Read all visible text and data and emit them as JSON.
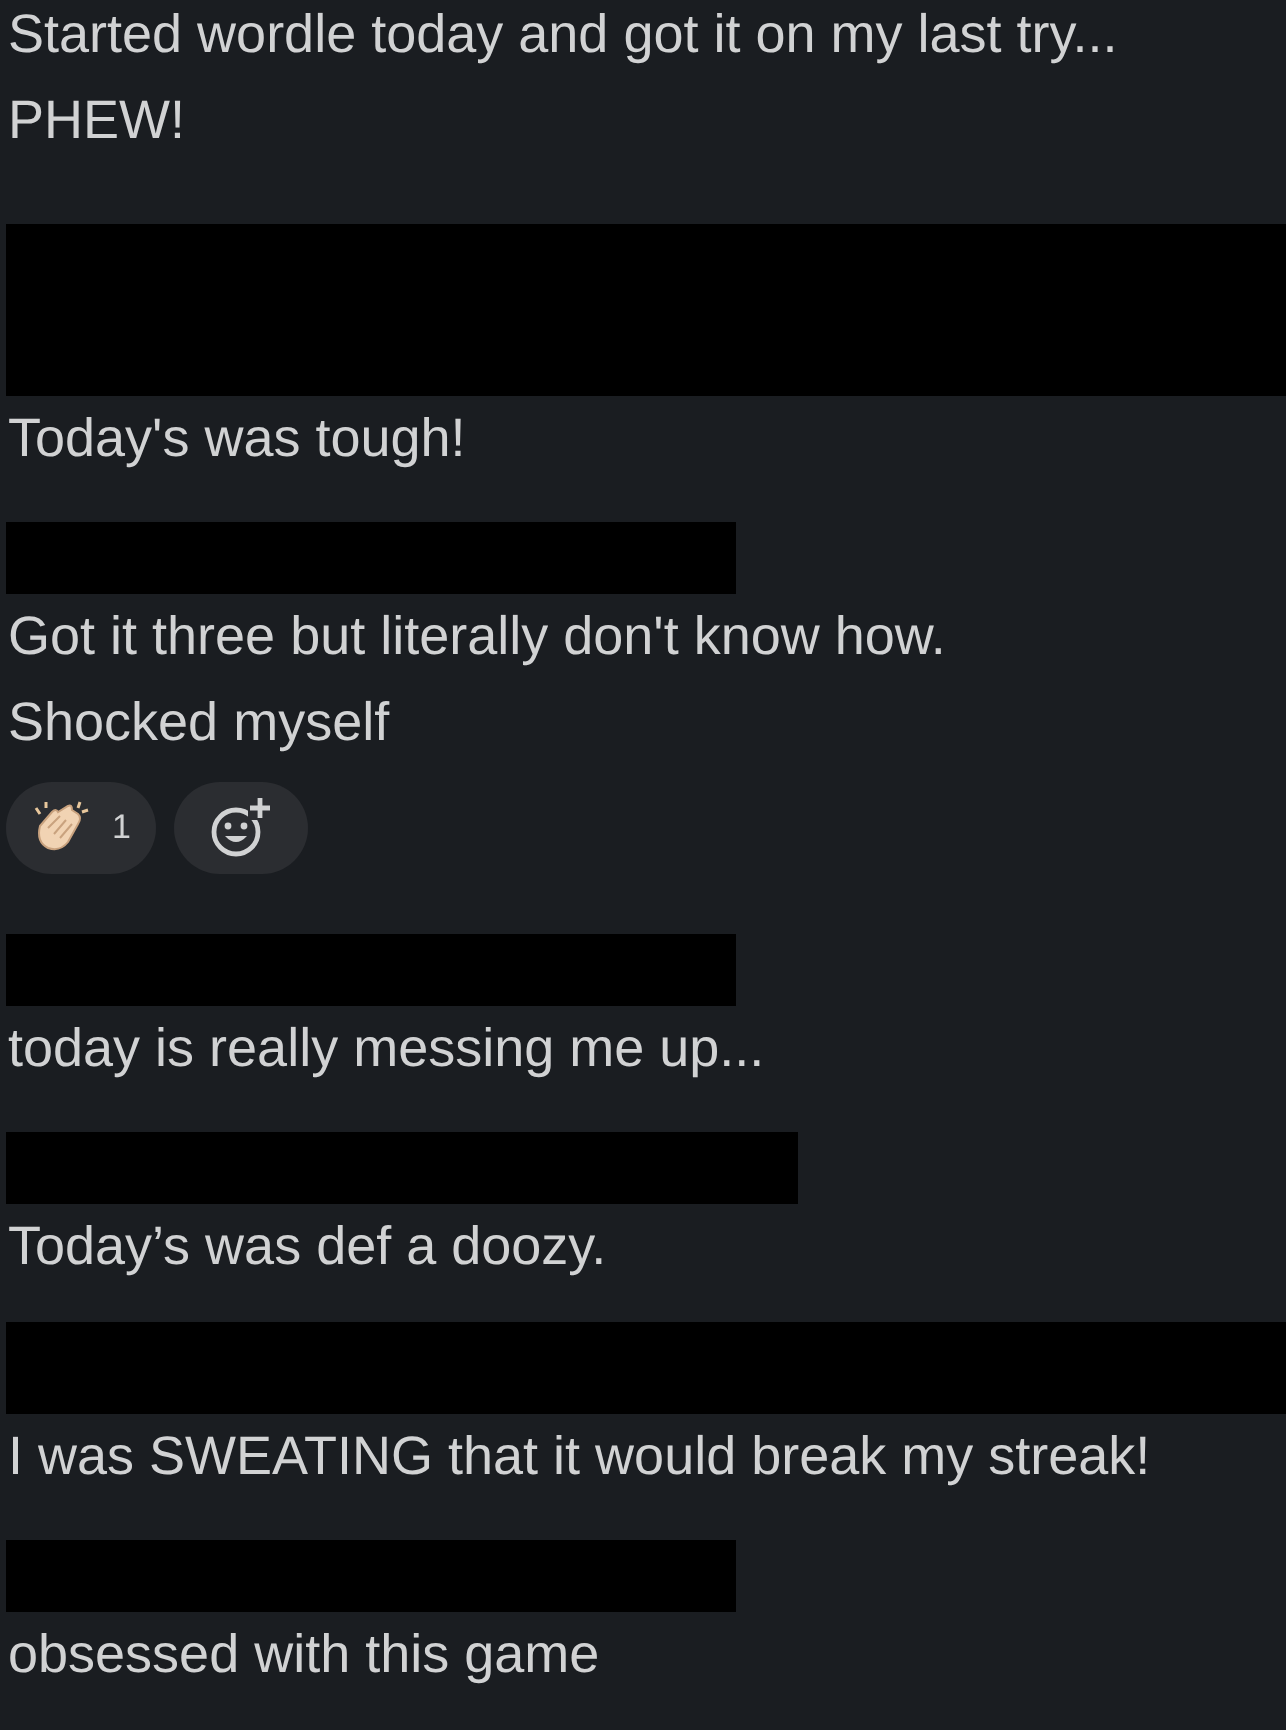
{
  "blocks": [
    {
      "kind": "text",
      "lines": [
        "Started wordle today and got it on my last try...",
        "PHEW!"
      ]
    },
    {
      "kind": "blackout"
    },
    {
      "kind": "text",
      "lines": [
        "Today's was tough!"
      ]
    },
    {
      "kind": "bar"
    },
    {
      "kind": "text",
      "lines": [
        "Got it three but literally don't know how.",
        "Shocked myself"
      ]
    },
    {
      "kind": "reactions",
      "items": [
        {
          "kind": "clap",
          "count": "1",
          "selected": false
        }
      ]
    },
    {
      "kind": "bar"
    },
    {
      "kind": "text",
      "lines": [
        "today is really messing me up..."
      ]
    },
    {
      "kind": "widebar"
    },
    {
      "kind": "text",
      "lines": [
        "Today’s was def a doozy."
      ]
    },
    {
      "kind": "fullbar"
    },
    {
      "kind": "text",
      "lines": [
        "I was SWEATING that it would break my streak!"
      ]
    },
    {
      "kind": "bar"
    },
    {
      "kind": "text",
      "lines": [
        "obsessed with this game"
      ]
    }
  ]
}
